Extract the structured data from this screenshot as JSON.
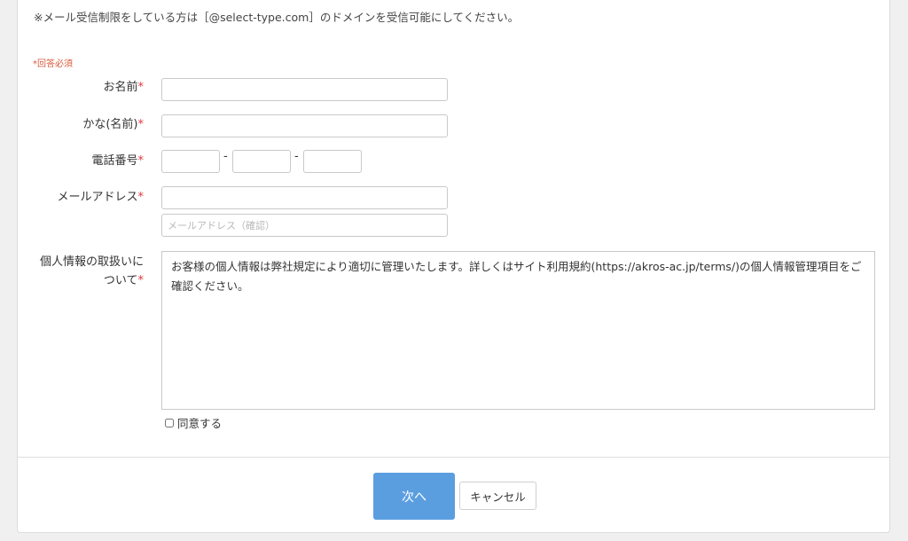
{
  "notice": "※メール受信制限をしている方は［@select-type.com］のドメインを受信可能にしてください。",
  "required_note": "*回答必須",
  "required_mark": "*",
  "fields": {
    "name": {
      "label": "お名前",
      "value": ""
    },
    "kana": {
      "label": "かな(名前)",
      "value": ""
    },
    "phone": {
      "label": "電話番号",
      "part1": "",
      "part2": "",
      "part3": "",
      "separator": "-"
    },
    "email": {
      "label": "メールアドレス",
      "value": "",
      "confirm_placeholder": "メールアドレス（確認）"
    },
    "privacy": {
      "label_line1": "個人情報の取扱いに",
      "label_line2": "ついて",
      "text": "お客様の個人情報は弊社規定により適切に管理いたします。詳しくはサイト利用規約(https://akros-ac.jp/terms/)の個人情報管理項目をご確認ください。",
      "agree_label": "同意する",
      "agree_checked": false
    }
  },
  "buttons": {
    "next_label": "次へ",
    "cancel_label": "キャンセル"
  },
  "colors": {
    "accent": "#5b9ee0",
    "required": "#e0383e",
    "required_note": "#d9593b"
  }
}
